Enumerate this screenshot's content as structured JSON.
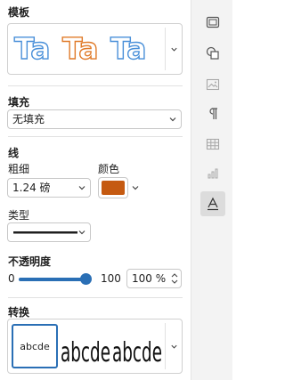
{
  "template": {
    "title": "模板",
    "samples": [
      {
        "text": "Ta",
        "color": "#4a90d9"
      },
      {
        "text": "Ta",
        "color": "#e07b2a"
      },
      {
        "text": "Ta",
        "color": "#4a90d9"
      }
    ]
  },
  "fill": {
    "title": "填充",
    "value": "无填充"
  },
  "line": {
    "title": "线",
    "weight_label": "粗细",
    "weight_value": "1.24 磅",
    "color_label": "颜色",
    "color": "#c55a11",
    "type_label": "类型"
  },
  "opacity": {
    "title": "不透明度",
    "min": "0",
    "max": "100",
    "value_text": "100 %",
    "value": 1.0,
    "accent": "#2a6fb5"
  },
  "transform": {
    "title": "转换",
    "selected_label": "abcde",
    "samples": [
      "abcde",
      "abcde"
    ]
  },
  "rail": {
    "icons": [
      "shape-icon",
      "shape-styles-icon",
      "picture-icon",
      "paragraph-icon",
      "table-icon",
      "chart-icon",
      "text-effects-icon"
    ],
    "active_index": 6
  }
}
